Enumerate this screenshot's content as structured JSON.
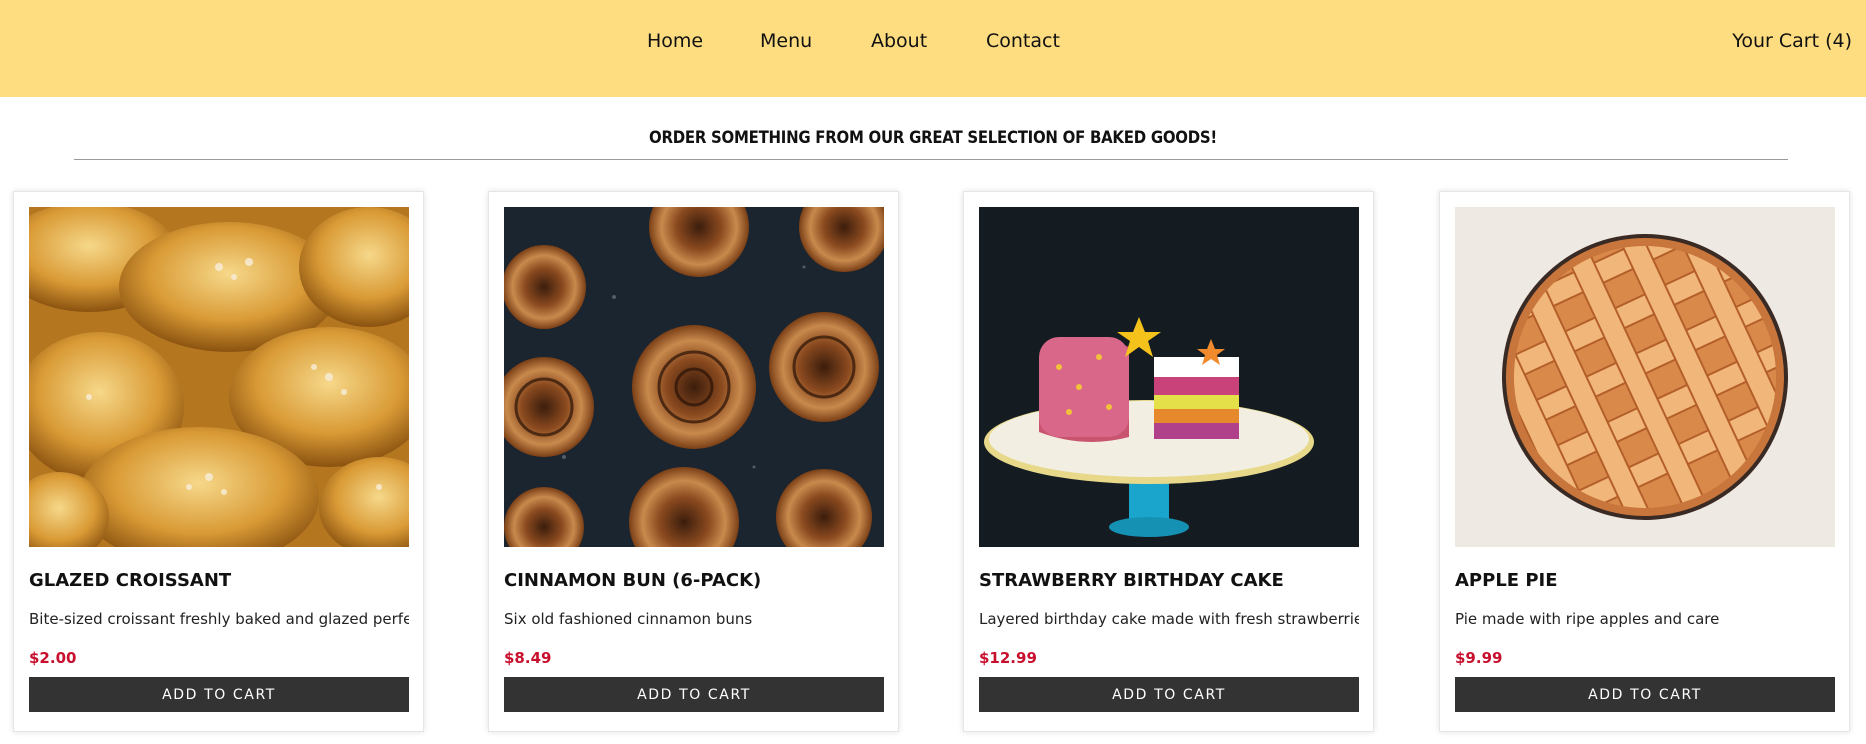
{
  "nav": {
    "links": [
      "Home",
      "Menu",
      "About",
      "Contact"
    ],
    "cart_label": "Your Cart (4)"
  },
  "main": {
    "heading": "ORDER SOMETHING FROM OUR GREAT SELECTION OF BAKED GOODS!",
    "products": [
      {
        "title": "GLAZED CROISSANT",
        "description": "Bite-sized croissant freshly baked and glazed perfec...",
        "price": "$2.00",
        "button_label": "ADD TO CART",
        "image": "croissant-photo"
      },
      {
        "title": "CINNAMON BUN (6-PACK)",
        "description": "Six old fashioned cinnamon buns",
        "price": "$8.49",
        "button_label": "ADD TO CART",
        "image": "cinnamon-bun-photo"
      },
      {
        "title": "STRAWBERRY BIRTHDAY CAKE",
        "description": "Layered birthday cake made with fresh strawberries",
        "price": "$12.99",
        "button_label": "ADD TO CART",
        "image": "birthday-cake-photo"
      },
      {
        "title": "APPLE PIE",
        "description": "Pie made with ripe apples and care",
        "price": "$9.99",
        "button_label": "ADD TO CART",
        "image": "apple-pie-photo"
      }
    ]
  },
  "colors": {
    "header_bg": "#fddd80",
    "price": "#c8102e",
    "button_bg": "#333333"
  }
}
